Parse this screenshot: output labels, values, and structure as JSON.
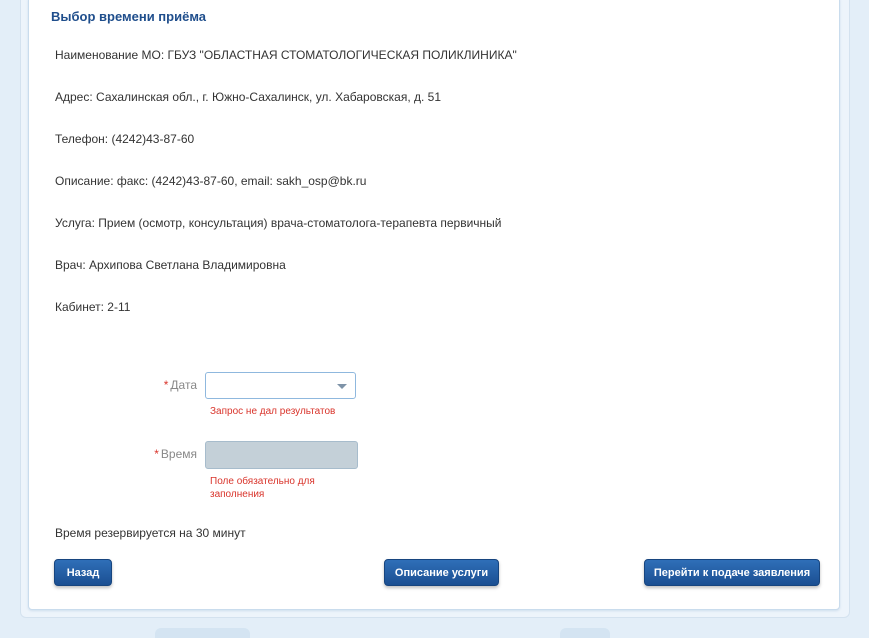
{
  "title": "Выбор времени приёма",
  "info": {
    "organization": "Наименование МО: ГБУЗ \"ОБЛАСТНАЯ СТОМАТОЛОГИЧЕСКАЯ ПОЛИКЛИНИКА\"",
    "address": "Адрес: Сахалинская обл., г. Южно-Сахалинск, ул. Хабаровская, д. 51",
    "phone": "Телефон: (4242)43-87-60",
    "description": "Описание: факс: (4242)43-87-60, email: sakh_osp@bk.ru",
    "service": "Услуга: Прием (осмотр, консультация) врача-стоматолога-терапевта первичный",
    "doctor": "Врач: Архипова Светлана Владимировна",
    "room": "Кабинет: 2-11"
  },
  "form": {
    "date": {
      "required_mark": "*",
      "label": "Дата",
      "value": "",
      "error": "Запрос не дал результатов"
    },
    "time": {
      "required_mark": "*",
      "label": "Время",
      "value": "",
      "error": "Поле обязательно для заполнения"
    }
  },
  "reserve_note": "Время резервируется на 30 минут",
  "buttons": {
    "back": "Назад",
    "service_description": "Описание услуги",
    "proceed": "Перейти к подаче заявления"
  }
}
